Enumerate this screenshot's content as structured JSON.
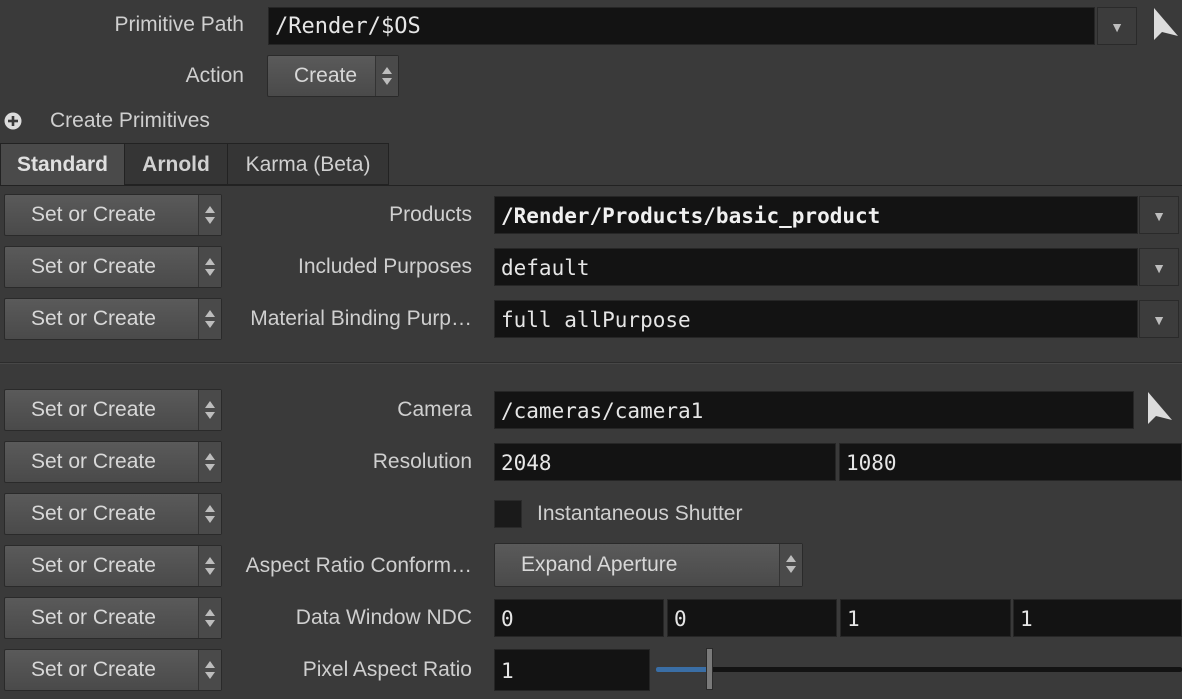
{
  "header": {
    "primitive_path_label": "Primitive Path",
    "primitive_path_value": "/Render/$OS",
    "action_label": "Action",
    "action_value": "Create",
    "create_primitives_label": "Create Primitives"
  },
  "tabs": [
    {
      "label": "Standard"
    },
    {
      "label": "Arnold"
    },
    {
      "label": "Karma (Beta)"
    }
  ],
  "set_or_create_label": "Set or Create",
  "rows": {
    "products": {
      "label": "Products",
      "value": "/Render/Products/basic_product"
    },
    "included_purposes": {
      "label": "Included Purposes",
      "value": "default"
    },
    "material_binding": {
      "label": "Material Binding Purp…",
      "value": "full allPurpose"
    },
    "camera": {
      "label": "Camera",
      "value": "/cameras/camera1"
    },
    "resolution": {
      "label": "Resolution",
      "values": [
        "2048",
        "1080"
      ]
    },
    "shutter": {
      "label": "Instantaneous Shutter",
      "checked": false
    },
    "aspect_conform": {
      "label": "Aspect Ratio Conform…",
      "value": "Expand Aperture"
    },
    "data_window": {
      "label": "Data Window NDC",
      "values": [
        "0",
        "0",
        "1",
        "1"
      ]
    },
    "pixel_aspect": {
      "label": "Pixel Aspect Ratio",
      "value": "1",
      "slider_fraction": 0.1
    }
  },
  "colors": {
    "background": "#3a3a3a",
    "field": "#131313",
    "slider_accent": "#3a6ea5"
  }
}
